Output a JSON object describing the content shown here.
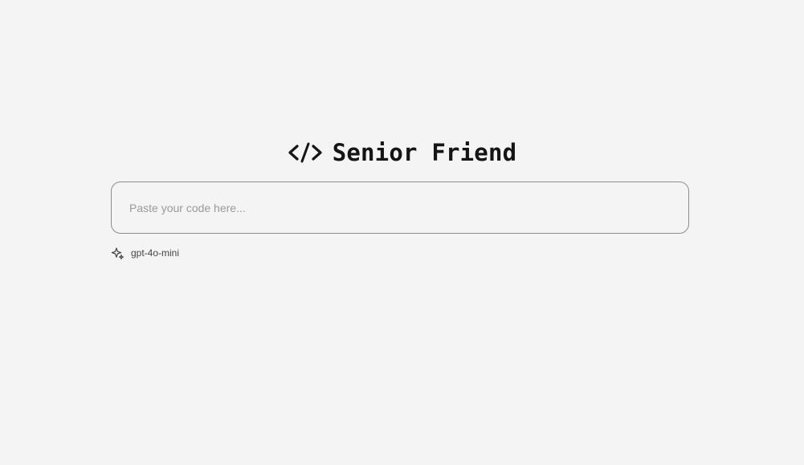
{
  "header": {
    "title": "Senior Friend",
    "logo_icon": "code-brackets-icon"
  },
  "editor": {
    "placeholder": "Paste your code here...",
    "value": ""
  },
  "model_selector": {
    "icon": "sparkles-icon",
    "label": "gpt-4o-mini"
  },
  "colors": {
    "background": "#f4f4f4",
    "title": "#151515",
    "border": "#8c8c8c",
    "placeholder": "#9a9a9a"
  }
}
